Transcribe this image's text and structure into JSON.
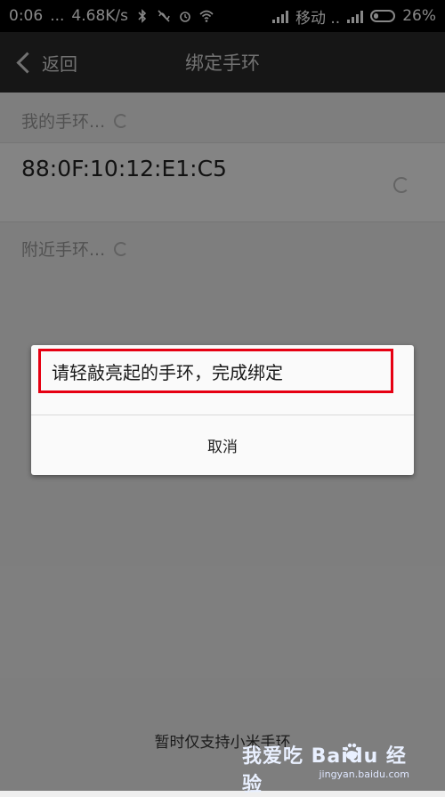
{
  "status_bar": {
    "time": "0:06",
    "dots": "...",
    "speed": "4.68K/s",
    "carrier": "移动 ..",
    "battery": "26%"
  },
  "title_bar": {
    "back_label": "返回",
    "title": "绑定手环"
  },
  "my_band": {
    "label": "我的手环...",
    "device_mac": "88:0F:10:12:E1:C5"
  },
  "nearby": {
    "label": "附近手环..."
  },
  "dialog": {
    "message": "请轻敲亮起的手环，完成绑定",
    "cancel_label": "取消",
    "highlight_color": "#e60012"
  },
  "bottom_note": "暂时仅支持小米手环",
  "watermark": {
    "text": "我爱吃 Baidu 经验",
    "domain": "jingyan.baidu.com"
  }
}
